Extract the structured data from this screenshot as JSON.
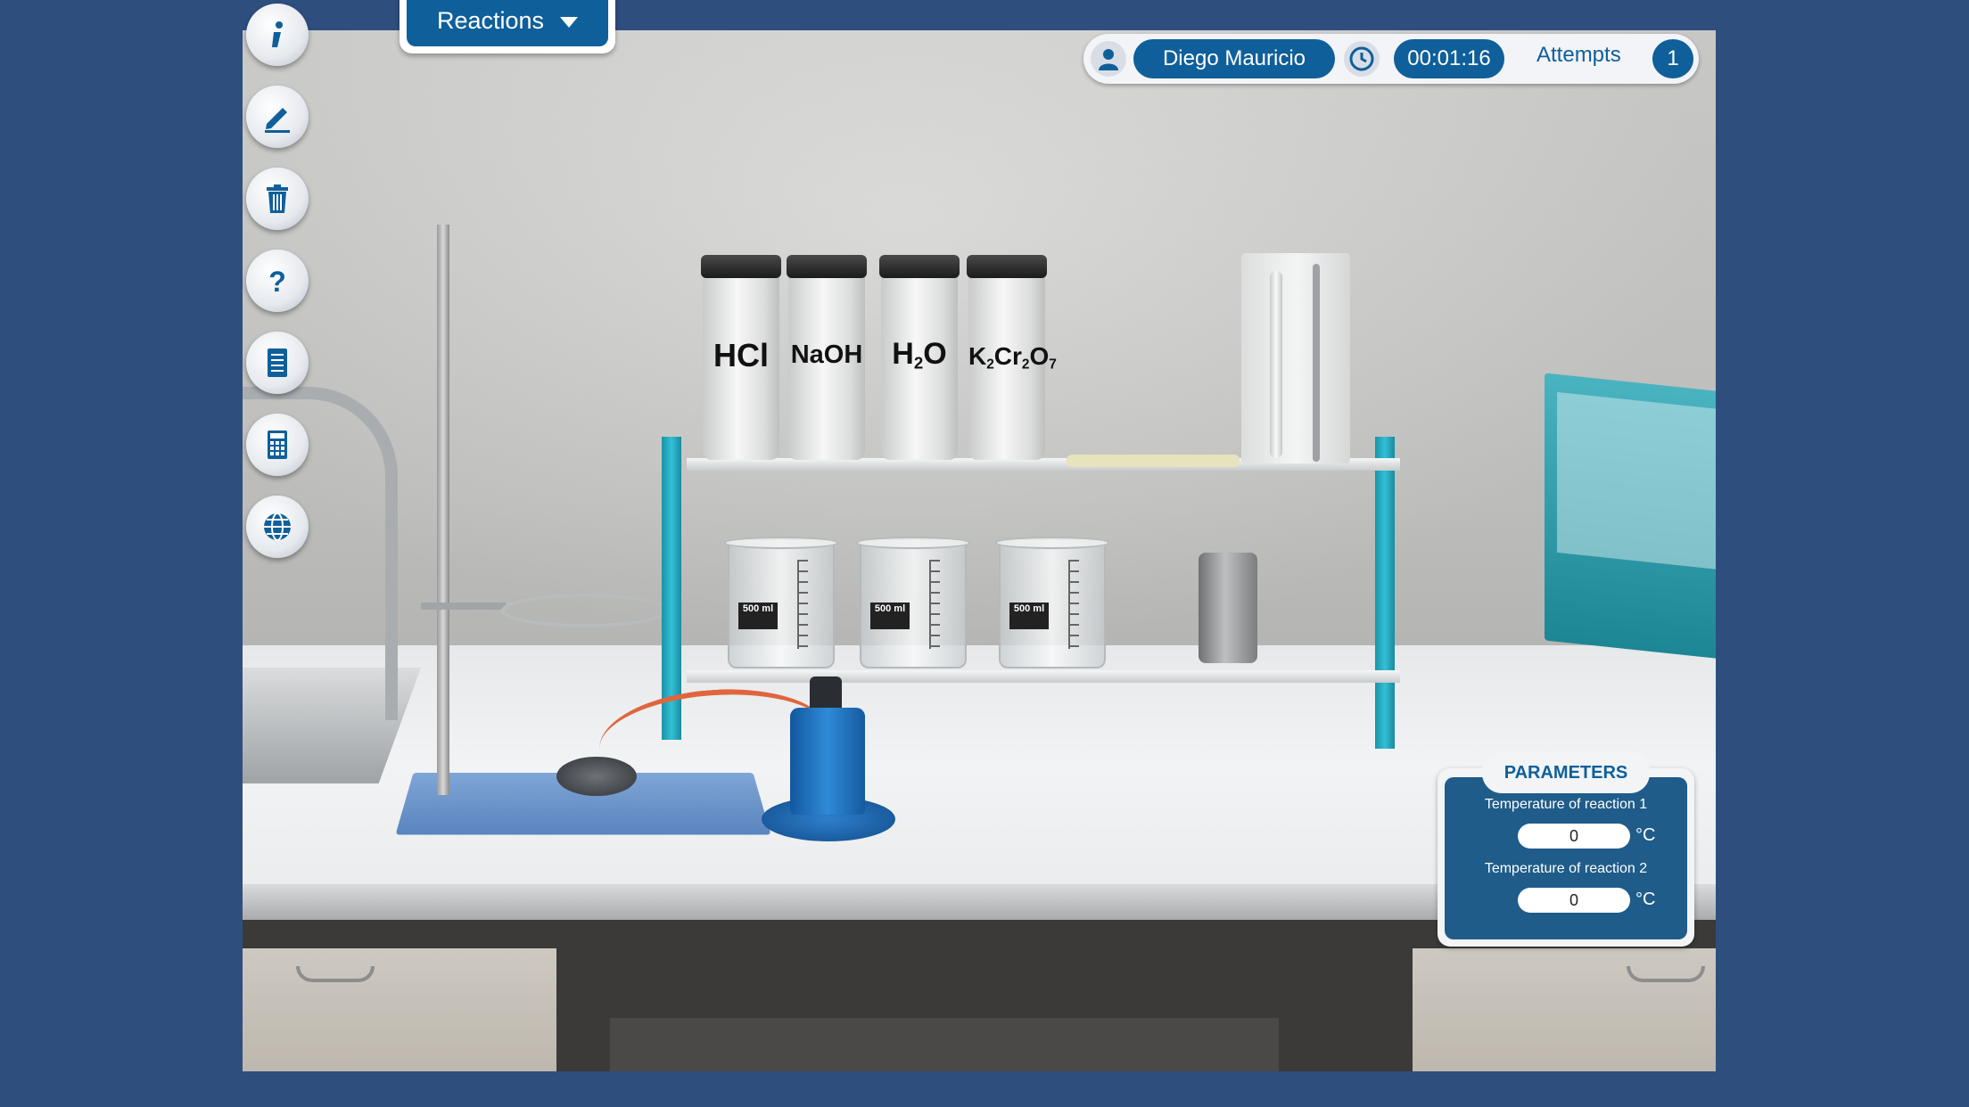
{
  "menu": {
    "reactions_label": "Reactions"
  },
  "header": {
    "user_name": "Diego Mauricio",
    "timer": "00:01:16",
    "attempts_label": "Attempts",
    "attempts_count": "1"
  },
  "sidebar": {
    "buttons": [
      {
        "name": "info",
        "icon": "info-icon"
      },
      {
        "name": "notes",
        "icon": "pencil-icon"
      },
      {
        "name": "trash",
        "icon": "trash-icon"
      },
      {
        "name": "help",
        "icon": "question-icon"
      },
      {
        "name": "procedure",
        "icon": "checklist-icon"
      },
      {
        "name": "calculator",
        "icon": "calculator-icon"
      },
      {
        "name": "language",
        "icon": "globe-icon"
      }
    ]
  },
  "lab": {
    "bottles": [
      "HCl",
      "NaOH",
      "H2O",
      "K2Cr2O7"
    ],
    "beaker_volume": "500 ml"
  },
  "parameters": {
    "title": "PARAMETERS",
    "temp1_label": "Temperature of reaction 1",
    "temp1_value": "0",
    "temp2_label": "Temperature of reaction 2",
    "temp2_value": "0",
    "unit": "°C"
  },
  "colors": {
    "background": "#2e4e7e",
    "accent": "#0f5f9a",
    "shelf": "#1ea4b8"
  }
}
